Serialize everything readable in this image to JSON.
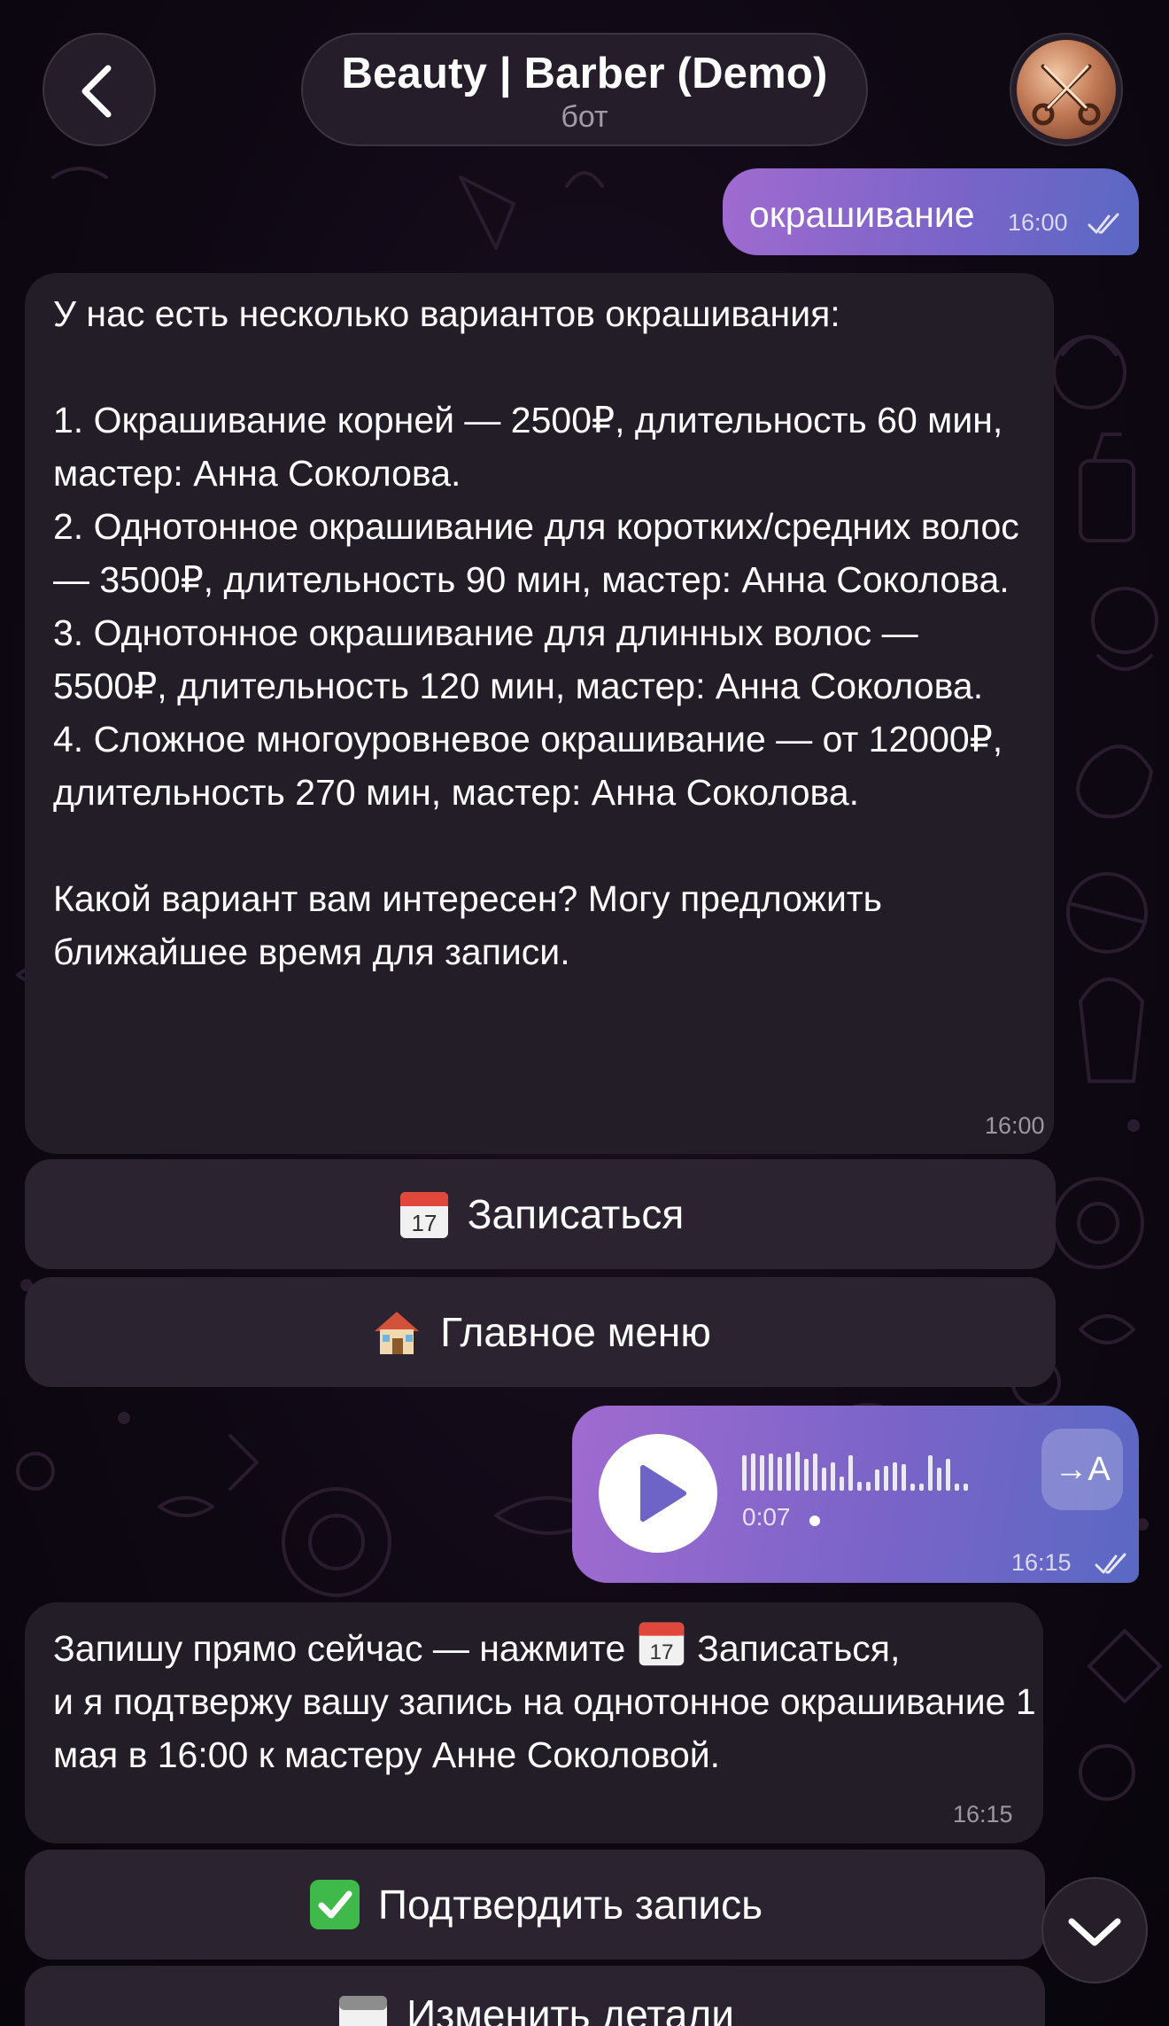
{
  "header": {
    "title": "Beauty | Barber (Demo)",
    "subtitle": "бот",
    "back_icon": "chevron-left-icon",
    "avatar_icon": "scissors-icon"
  },
  "messages": [
    {
      "direction": "outgoing",
      "text": "окрашивание",
      "time": "16:00",
      "status": "read"
    },
    {
      "direction": "incoming",
      "text": "У нас есть несколько вариантов окрашивания:\n\n1. Окрашивание корней — 2500₽, длительность 60 мин, мастер: Анна Соколова.\n2. Однотонное окрашивание для коротких/средних волос — 3500₽, длительность 90 мин, мастер: Анна Соколова.\n3. Однотонное окрашивание для длинных волос — 5500₽, длительность 120 мин, мастер: Анна Соколова.\n4. Сложное многоуровневое окрашивание — от 12000₽, длительность 270 мин, мастер: Анна Соколова.\n\nКакой вариант вам интересен? Могу предложить ближайшее время для записи.",
      "time": "16:00",
      "buttons": [
        {
          "icon": "calendar-icon",
          "label": "Записаться"
        },
        {
          "icon": "house-icon",
          "label": "Главное меню"
        }
      ]
    },
    {
      "direction": "outgoing",
      "type": "voice",
      "duration": "0:07",
      "transcribe_label": "→A",
      "time": "16:15",
      "status": "read"
    },
    {
      "direction": "incoming",
      "text_before": "Запишу прямо сейчас — нажмите ",
      "text_after": " Записаться,\nи я подтвержу вашу запись на однотонное окрашивание 1 мая в 16:00 к мастеру Анне Соколовой.",
      "inline_icon": "calendar-icon",
      "time": "16:15",
      "buttons": [
        {
          "icon": "check-mark-icon",
          "label": "Подтвердить запись"
        },
        {
          "icon": "calendar-icon",
          "label": "Изменить детали"
        }
      ]
    }
  ],
  "colors": {
    "background": "#0d0712",
    "incoming_bubble": "#231d27",
    "outgoing_gradient_start": "#a06bd0",
    "outgoing_gradient_end": "#5a69c4",
    "keyboard_button": "#2b2430",
    "header_pill": "#28202c"
  },
  "scroll_down_icon": "chevron-down-icon"
}
